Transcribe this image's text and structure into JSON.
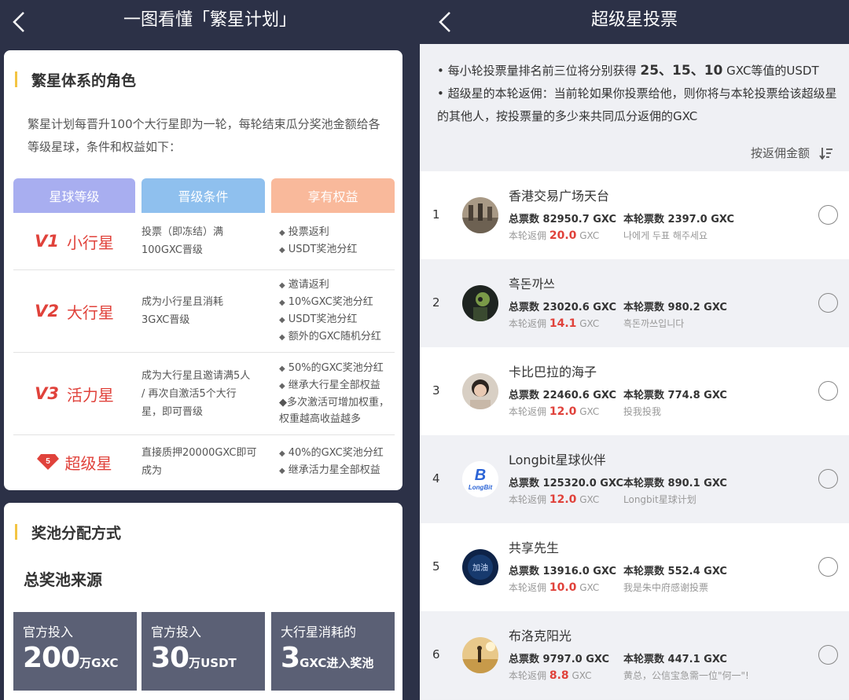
{
  "left": {
    "nav_title": "一图看懂「繁星计划」",
    "roles": {
      "title": "繁星体系的角色",
      "intro": "繁星计划每晋升100个大行星即为一轮，每轮结束瓜分奖池金额给各等级星球，条件和权益如下：",
      "headers": {
        "level": "星球等级",
        "condition": "晋级条件",
        "benefit": "享有权益"
      },
      "rows": [
        {
          "prefix": "V1",
          "name": "小行星",
          "condition": "投票（即冻结）满100GXC晋级",
          "benefits": [
            "投票返利",
            "USDT奖池分红"
          ]
        },
        {
          "prefix": "V2",
          "name": "大行星",
          "condition": "成为小行星且消耗3GXC晋级",
          "benefits": [
            "邀请返利",
            "10%GXC奖池分红",
            "USDT奖池分红",
            "额外的GXC随机分红"
          ]
        },
        {
          "prefix": "V3",
          "name": "活力星",
          "condition": "成为大行星且邀请满5人 / 再次自激活5个大行星，即可晋级",
          "benefits": [
            "50%的GXC奖池分红",
            "继承大行星全部权益",
            "多次激活可增加权重，权重越高收益越多"
          ]
        },
        {
          "prefix": "5",
          "name": "超级星",
          "condition": "直接质押20000GXC即可成为",
          "benefits": [
            "40%的GXC奖池分红",
            "继承活力星全部权益"
          ]
        }
      ]
    },
    "pool": {
      "title": "奖池分配方式",
      "subtitle": "总奖池来源",
      "boxes": [
        {
          "label": "官方投入",
          "number": "200",
          "unit": "万GXC"
        },
        {
          "label": "官方投入",
          "number": "30",
          "unit": "万USDT"
        },
        {
          "label": "大行星消耗的",
          "number": "3",
          "unit": "GXC进入奖池"
        }
      ]
    }
  },
  "right": {
    "nav_title": "超级星投票",
    "notice": {
      "line1_pre": "• 每小轮投票量排名前三位将分别获得 ",
      "line1_nums": "25、15、10",
      "line1_post": " GXC等值的USDT",
      "line2": "• 超级星的本轮返佣：当前轮如果你投票给他，则你将与本轮投票给该超级星的其他人，按投票量的多少来共同瓜分返佣的GXC"
    },
    "sort_label": "按返佣金额",
    "rows": [
      {
        "rank": "1",
        "name": "香港交易广场天台",
        "total": "总票数 82950.7 GXC",
        "round": "本轮票数 2397.0 GXC",
        "rebate_label": "本轮返佣",
        "rebate_value": "20.0",
        "rebate_unit": "GXC",
        "message": "나에게 두표 해주세요"
      },
      {
        "rank": "2",
        "name": "흑돈까쓰",
        "total": "总票数 23020.6 GXC",
        "round": "本轮票数 980.2 GXC",
        "rebate_label": "本轮返佣",
        "rebate_value": "14.1",
        "rebate_unit": "GXC",
        "message": "흑돈까쓰입니다"
      },
      {
        "rank": "3",
        "name": "卡比巴拉的海子",
        "total": "总票数 22460.6 GXC",
        "round": "本轮票数 774.8 GXC",
        "rebate_label": "本轮返佣",
        "rebate_value": "12.0",
        "rebate_unit": "GXC",
        "message": "投我投我"
      },
      {
        "rank": "4",
        "name": "Longbit星球伙伴",
        "total": "总票数 125320.0 GXC",
        "round": "本轮票数 890.1 GXC",
        "rebate_label": "本轮返佣",
        "rebate_value": "12.0",
        "rebate_unit": "GXC",
        "message": "Longbit星球计划"
      },
      {
        "rank": "5",
        "name": "共享先生",
        "total": "总票数 13916.0 GXC",
        "round": "本轮票数 552.4 GXC",
        "rebate_label": "本轮返佣",
        "rebate_value": "10.0",
        "rebate_unit": "GXC",
        "message": "我是朱中府感谢投票"
      },
      {
        "rank": "6",
        "name": "布洛克阳光",
        "total": "总票数 9797.0 GXC",
        "round": "本轮票数 447.1 GXC",
        "rebate_label": "本轮返佣",
        "rebate_value": "8.8",
        "rebate_unit": "GXC",
        "message": "黄总，公信宝急需一位\"何一\"!"
      }
    ],
    "avatar_logo_text": "LongBit",
    "avatar_badge_text": "加油"
  },
  "colors": {
    "navy": "#2c3147",
    "accent_red": "#e0423b",
    "gold": "#f3c443"
  }
}
